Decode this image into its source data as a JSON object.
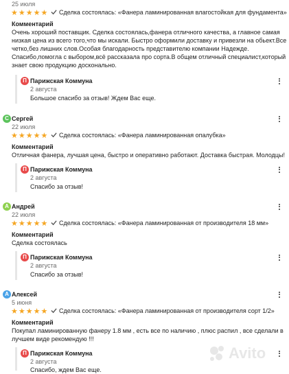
{
  "reviews": [
    {
      "name": "",
      "date": "25 июля",
      "stars": "★★★★★",
      "deal": "Сделка состоялась: «Фанера ламинированная влагостойкая для фундамента»",
      "comment_title": "Комментарий",
      "comment": [
        "Очень хороший поставщик. Сделка состоялась,фанера отличного качества, а главное самая",
        "низкая цена из всего того,что мы искали. Быстро оформили доставку и привезли на обьект.Все",
        "четко,без лишних слов.Особая благодарность представителю компании Надежде.",
        "Спасибо,помогла с выбором,всё рассказала про сорта.В общем отличный специалист,который",
        "знает свою продукцию досконально."
      ],
      "reply": {
        "avatar_letter": "П",
        "name": "Парижская Коммуна",
        "date": "2 августа",
        "text": "Большое спасибо за отзыв! Ждем Вас еще."
      }
    },
    {
      "avatar_letter": "С",
      "name": "Сергей",
      "date": "22 июля",
      "stars": "★★★★★",
      "deal": "Сделка состоялась: «Фанера ламинированная опалубка»",
      "comment_title": "Комментарий",
      "comment": [
        "Отличная фанера, лучшая цена, быстро и оперативно работают. Доставка быстрая. Молодцы!"
      ],
      "reply": {
        "avatar_letter": "П",
        "name": "Парижская Коммуна",
        "date": "2 августа",
        "text": "Спасибо за отзыв!"
      }
    },
    {
      "avatar_letter": "А",
      "name": "Андрей",
      "date": "22 июля",
      "stars": "★★★★★",
      "deal": "Сделка состоялась: «Фанера ламинированная от производителя 18 мм»",
      "comment_title": "Комментарий",
      "comment": [
        "Сделка состоялась"
      ],
      "reply": {
        "avatar_letter": "П",
        "name": "Парижская Коммуна",
        "date": "2 августа",
        "text": "Спасибо за отзыв!"
      }
    },
    {
      "avatar_letter": "А",
      "name": "Алексей",
      "date": "5 июня",
      "stars": "★★★★★",
      "deal": "Сделка состоялась: «Фанера ламинированная от производителя сорт 1/2»",
      "comment_title": "Комментарий",
      "comment": [
        "Покупал ламинированную фанеру 1.8 мм , есть все по наличию , плюс распил , все сделали в",
        "лучшем виде рекомендую !!!"
      ],
      "reply": {
        "avatar_letter": "П",
        "name": "Парижская Коммуна",
        "date": "2 августа",
        "text": "Спасибо, ждем Вас еще."
      }
    }
  ],
  "watermark": "Avito",
  "colors": {
    "star": "#f5a623",
    "avatar_reply": "#e84a4a",
    "avatar_sergey": "#5cc35c",
    "avatar_andrey": "#8fd14f",
    "avatar_aleksey": "#4aa3e8"
  }
}
